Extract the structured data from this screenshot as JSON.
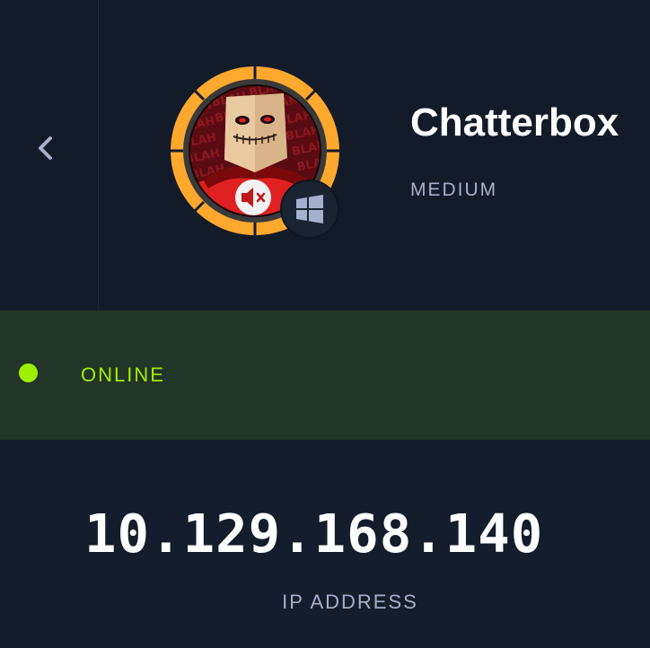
{
  "machine": {
    "name": "Chatterbox",
    "difficulty": "MEDIUM",
    "os": "windows",
    "avatar_text": "BLAH"
  },
  "status": {
    "label": "ONLINE",
    "color": "#9fef00"
  },
  "ip": {
    "value": "10.129.168.140",
    "label": "IP ADDRESS"
  },
  "icons": {
    "back": "chevron-left-icon",
    "os": "windows-icon",
    "mute": "speaker-muted-icon"
  },
  "colors": {
    "background": "#141d2b",
    "difficulty_ring": "#ffa82e",
    "status_bg": "#233428",
    "accent_green": "#9fef00",
    "muted_text": "#a4b1cd"
  }
}
